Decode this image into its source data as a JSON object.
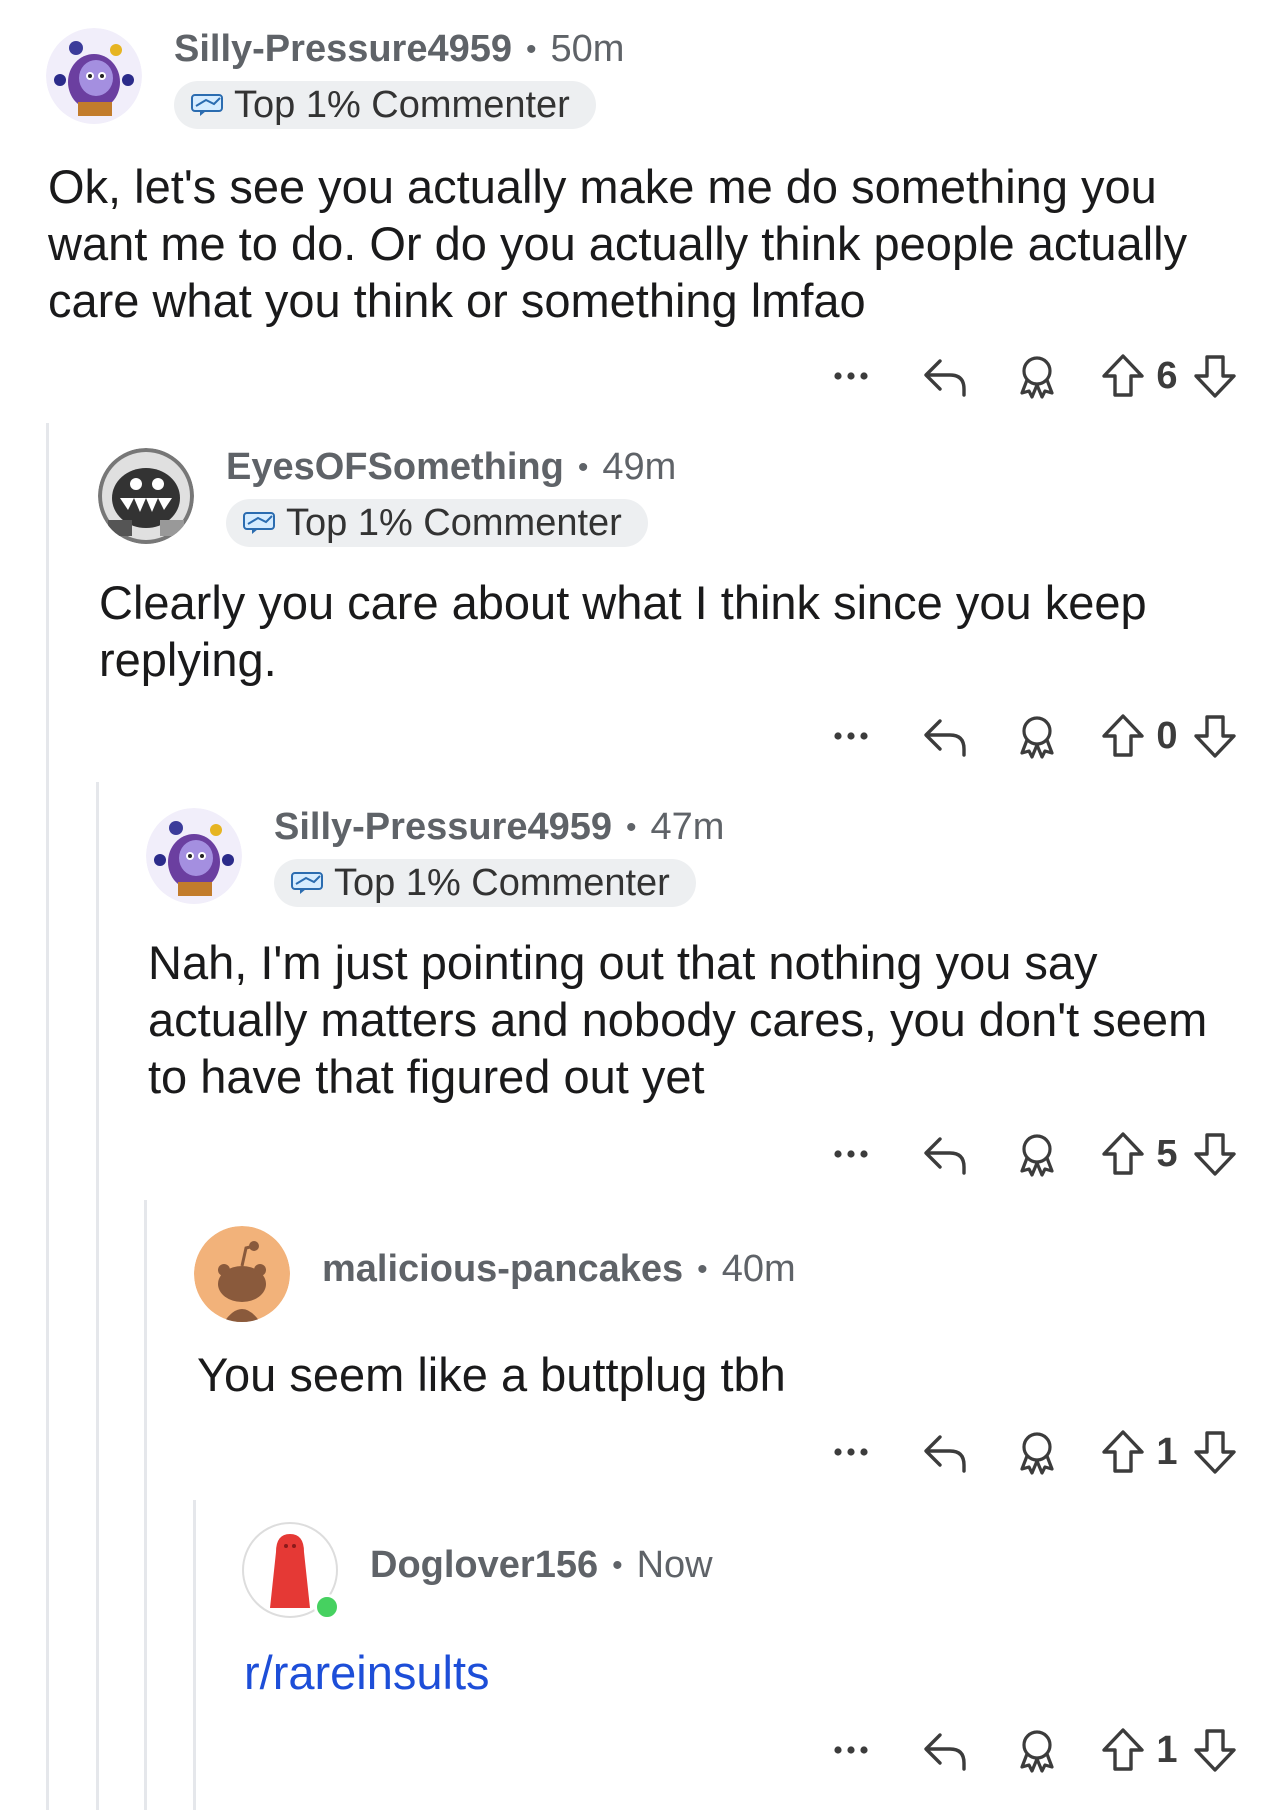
{
  "comments": [
    {
      "username": "Silly-Pressure4959",
      "time": "50m",
      "flair": "Top 1% Commenter",
      "body": "Ok, let's see you actually make me do something you want me to do. Or do you actually think people actually care what you think or something lmfao",
      "score": "6",
      "avatar": "purple-character-avatar"
    },
    {
      "username": "EyesOFSomething",
      "time": "49m",
      "flair": "Top 1% Commenter",
      "body": "Clearly you care about what I think since you keep replying.",
      "score": "0",
      "avatar": "grayscale-creature-avatar"
    },
    {
      "username": "Silly-Pressure4959",
      "time": "47m",
      "flair": "Top 1% Commenter",
      "body": "Nah, I'm just pointing out that nothing you say actually matters and nobody cares, you don't seem to have that figured out yet",
      "score": "5",
      "avatar": "purple-character-avatar"
    },
    {
      "username": "malicious-pancakes",
      "time": "40m",
      "flair": "",
      "body": "You seem like a buttplug tbh",
      "score": "1",
      "avatar": "default-snoo-avatar"
    },
    {
      "username": "Doglover156",
      "time": "Now",
      "flair": "",
      "body": "r/rareinsults",
      "score": "1",
      "avatar": "red-robed-avatar"
    }
  ],
  "separator": "•",
  "icons": {
    "more": "more-icon",
    "reply": "reply-icon",
    "award": "award-icon",
    "upvote": "upvote-icon",
    "downvote": "downvote-icon",
    "flair": "flair-badge-icon"
  },
  "colors": {
    "link": "#1d4ed8",
    "thread_line": "#e5e7eb",
    "flair_bg": "#edeff1",
    "online": "#46d160"
  }
}
